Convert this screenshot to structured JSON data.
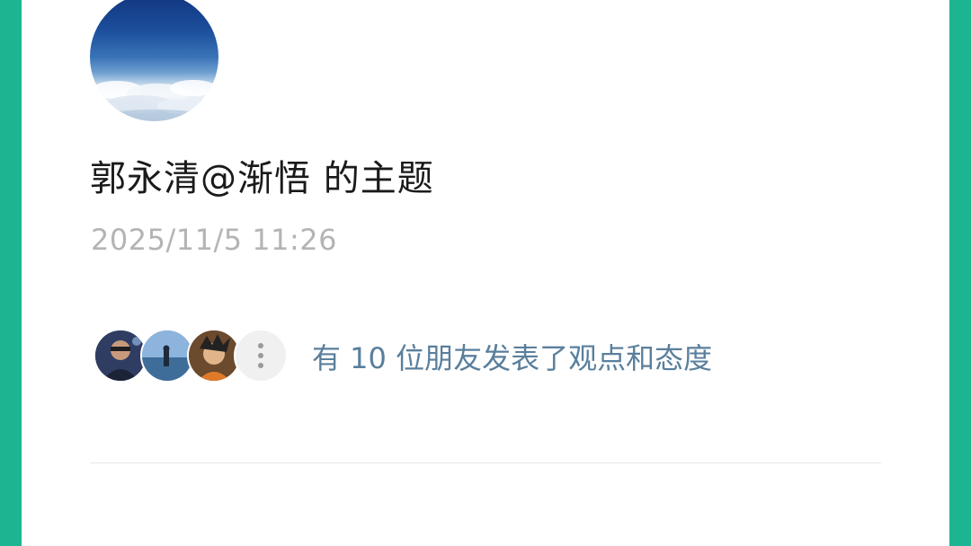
{
  "post": {
    "title": "郭永清@渐悟 的主题",
    "timestamp": "2025/11/5 11:26"
  },
  "reactions": {
    "summary": "有 10 位朋友发表了观点和态度",
    "more_icon": "more-vertical-icon"
  },
  "colors": {
    "frame": "#1db591",
    "card": "#ffffff",
    "title_text": "#1a1a1a",
    "timestamp_text": "#b4b4b4",
    "link_text": "#5a7f9c"
  }
}
